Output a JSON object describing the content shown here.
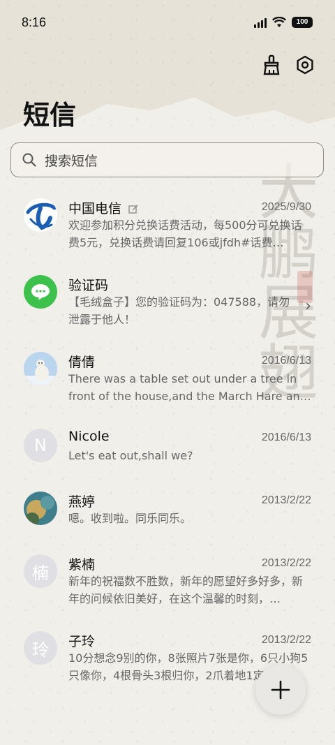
{
  "status_bar": {
    "time": "8:16",
    "battery": "100"
  },
  "header": {
    "title": "短信"
  },
  "search": {
    "placeholder": "搜索短信"
  },
  "watermark": "大鹏展翅",
  "messages": [
    {
      "name": "中国电信",
      "date": "2025/9/30",
      "preview": "欢迎参加积分兑换话费活动，每500分可兑换话费5元，兑换话费请回复106或jfdh#话费…",
      "avatar": "telecom-logo-icon",
      "avatar_letter": ""
    },
    {
      "name": "验证码",
      "date": "",
      "preview": "【毛绒盒子】您的验证码为：047588，请勿泄露于他人！",
      "avatar": "message-bubble-icon",
      "avatar_letter": ""
    },
    {
      "name": "倩倩",
      "date": "2016/6/13",
      "preview": "There was a table set out under a tree in front of the house,and the March Hare an…",
      "avatar": "polar-bear-photo",
      "avatar_letter": ""
    },
    {
      "name": "Nicole",
      "date": "2016/6/13",
      "preview": "Let's eat out,shall we?",
      "avatar": "letter",
      "avatar_letter": "N"
    },
    {
      "name": "燕婷",
      "date": "2013/2/22",
      "preview": "嗯。收到啦。同乐同乐。",
      "avatar": "landscape-photo",
      "avatar_letter": ""
    },
    {
      "name": "紫楠",
      "date": "2013/2/22",
      "preview": "新年的祝福数不胜数，新年的愿望好多好多，新年的问候依旧美好，在这个温馨的时刻，…",
      "avatar": "letter",
      "avatar_letter": "楠"
    },
    {
      "name": "子玲",
      "date": "2013/2/22",
      "preview": "10分想念9别的你，8张照片7张是你，6只小狗5只像你，4根骨头3根归你，2爪着地1定…",
      "avatar": "letter",
      "avatar_letter": "玲"
    }
  ],
  "colors": {
    "telecom": "#1a5fb4",
    "verify_green": "#3cc24a",
    "letter_avatar": "#e0dfe3"
  }
}
